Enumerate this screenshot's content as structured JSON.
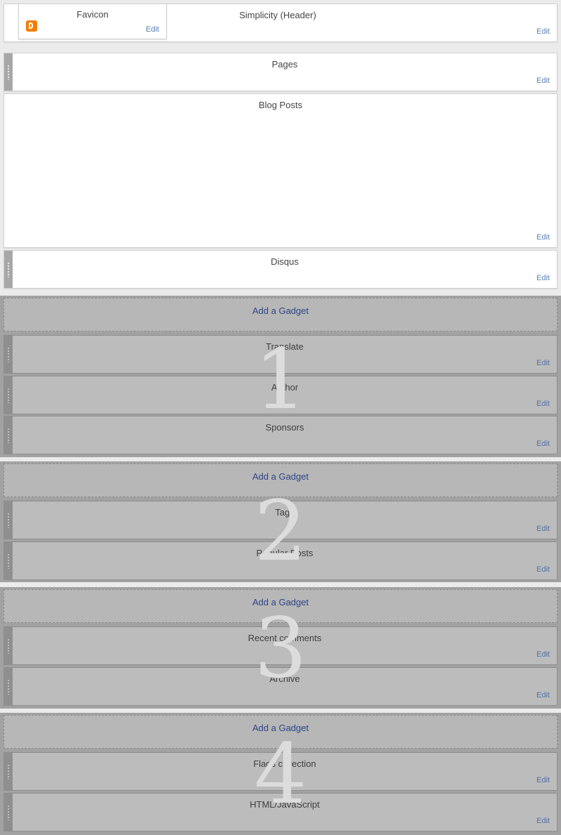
{
  "edit_label": "Edit",
  "header_area": {
    "favicon": {
      "title": "Favicon",
      "icon": "blogger-icon",
      "icon_color": "#f57d00",
      "edit": "Edit"
    },
    "header": {
      "title": "Simplicity (Header)",
      "edit": "Edit"
    }
  },
  "main": {
    "pages": {
      "title": "Pages",
      "edit": "Edit"
    },
    "blog_posts": {
      "title": "Blog Posts",
      "edit": "Edit"
    },
    "disqus": {
      "title": "Disqus",
      "edit": "Edit"
    }
  },
  "sidebar_sections": [
    {
      "number": "1",
      "add_gadget": "Add a Gadget",
      "gadgets": [
        {
          "title": "Translate",
          "edit": "Edit"
        },
        {
          "title": "Author",
          "edit": "Edit"
        },
        {
          "title": "Sponsors",
          "edit": "Edit"
        }
      ]
    },
    {
      "number": "2",
      "add_gadget": "Add a Gadget",
      "gadgets": [
        {
          "title": "Tags",
          "edit": "Edit"
        },
        {
          "title": "Popular Posts",
          "edit": "Edit"
        }
      ]
    },
    {
      "number": "3",
      "add_gadget": "Add a Gadget",
      "gadgets": [
        {
          "title": "Recent comments",
          "edit": "Edit"
        },
        {
          "title": "Archive",
          "edit": "Edit"
        }
      ]
    },
    {
      "number": "4",
      "add_gadget": "Add a Gadget",
      "gadgets": [
        {
          "title": "Flags collection",
          "edit": "Edit"
        },
        {
          "title": "HTML/JavaScript",
          "edit": "Edit"
        }
      ]
    }
  ],
  "colors": {
    "page_background": "#ebebeb",
    "section_background": "#a2a2a2",
    "link_blue": "#2c4587",
    "edit_blue": "#5b7fb6",
    "blogger_orange": "#f57d00"
  }
}
